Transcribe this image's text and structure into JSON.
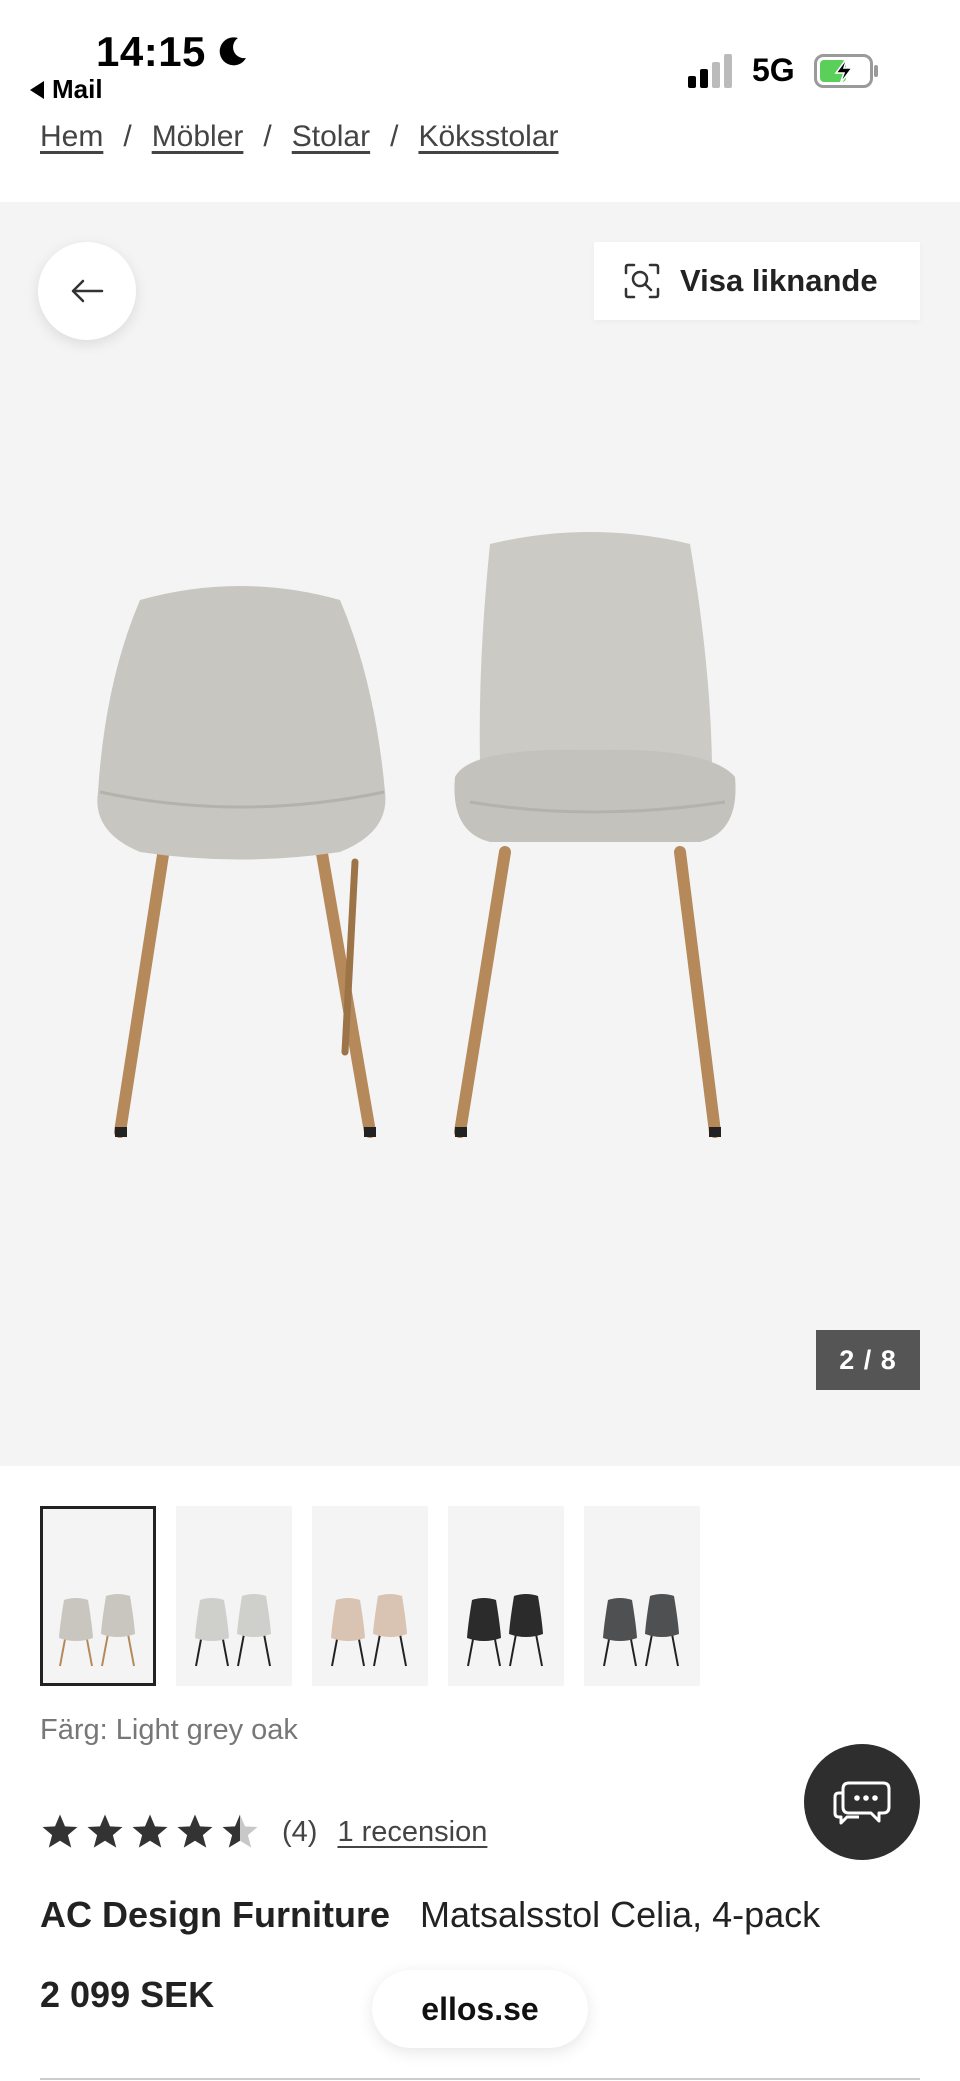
{
  "status_bar": {
    "time": "14:15",
    "back_app": "Mail",
    "network": "5G"
  },
  "breadcrumb": [
    "Hem",
    "Möbler",
    "Stolar",
    "Köksstolar"
  ],
  "gallery": {
    "similar_label": "Visa liknande",
    "counter": "2 / 8",
    "current_image": 2,
    "total_images": 8
  },
  "thumbnails": [
    {
      "name": "light-grey-oak",
      "seat": "#c9c6c0",
      "legs": "#b5895a",
      "selected": true
    },
    {
      "name": "light-grey-black",
      "seat": "#cfcfcb",
      "legs": "#222222",
      "selected": false
    },
    {
      "name": "beige-black",
      "seat": "#d9c4b3",
      "legs": "#222222",
      "selected": false
    },
    {
      "name": "black-black",
      "seat": "#2b2b2b",
      "legs": "#222222",
      "selected": false
    },
    {
      "name": "dark-grey-black",
      "seat": "#4f5052",
      "legs": "#222222",
      "selected": false
    }
  ],
  "product": {
    "color_label": "Färg: Light grey oak",
    "rating_value": 4.5,
    "rating_count": "(4)",
    "reviews_link": "1 recension",
    "brand": "AC Design Furniture",
    "name": "Matsalsstol Celia, 4-pack",
    "price": "2 099 SEK"
  },
  "site_label": "ellos.se",
  "colors": {
    "gallery_bg": "#f4f4f4",
    "chair_fabric": "#c7c6c1",
    "oak_legs": "#b5895a",
    "counter_bg": "#555555",
    "chat_bg": "#2e2e2e",
    "text_dark": "#222222"
  },
  "icons": {
    "back": "arrow-left-icon",
    "similar": "visual-search-icon",
    "chat": "chat-bubbles-icon",
    "star": "star-icon"
  }
}
